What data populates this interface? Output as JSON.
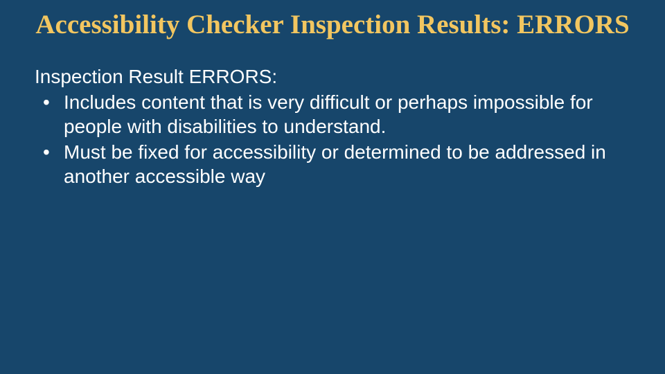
{
  "slide": {
    "title": "Accessibility Checker Inspection Results: ERRORS",
    "lead": "Inspection Result ERRORS:",
    "bullets": [
      "Includes content that is very difficult or perhaps impossible for people with disabilities to understand.",
      "Must be fixed for accessibility or determined to be addressed in another accessible way"
    ]
  }
}
